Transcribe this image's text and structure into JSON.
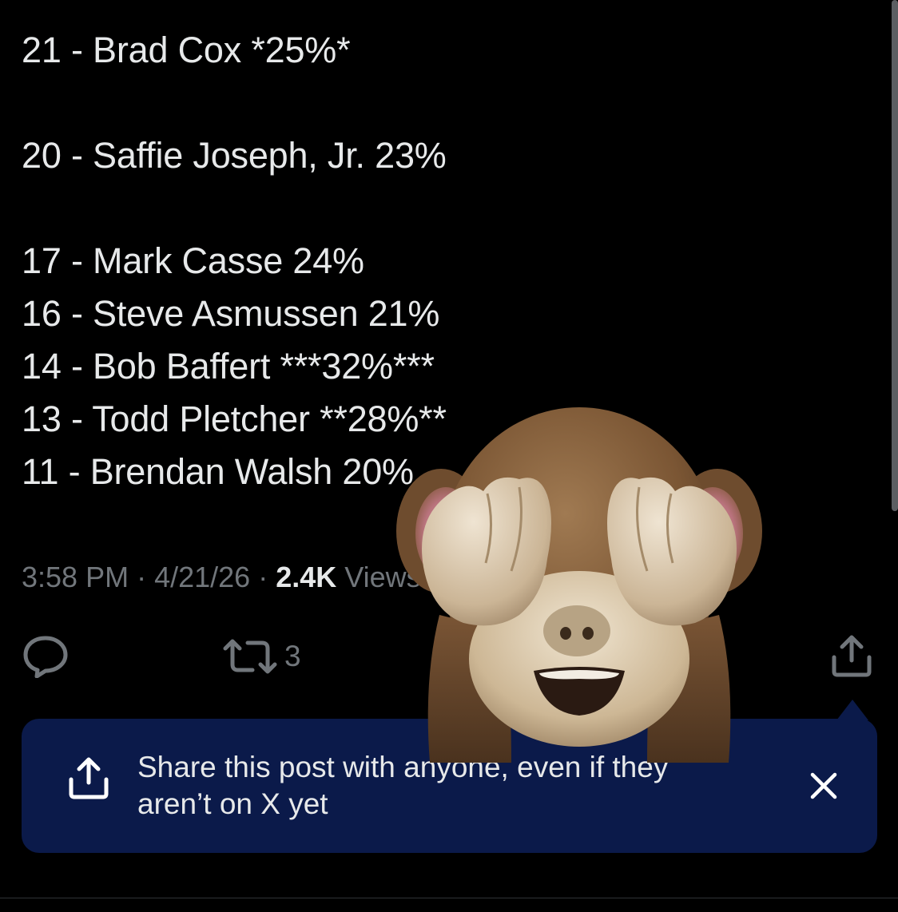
{
  "post": {
    "lines": [
      "21 - Brad Cox *25%*",
      "20 - Saffie Joseph, Jr. 23%",
      "17 - Mark Casse 24%",
      "16 - Steve Asmussen 21%",
      "14 - Bob Baffert ***32%***",
      "13 - Todd Pletcher **28%**",
      "11 - Brendan Walsh 20%"
    ]
  },
  "meta": {
    "time": "3:58 PM",
    "separator": " · ",
    "date": "4/21/26",
    "views_count": "2.4K",
    "views_label": " Views"
  },
  "actions": {
    "reply_icon": "reply-icon",
    "repost_icon": "repost-icon",
    "repost_count": "3",
    "share_icon": "share-icon"
  },
  "share_toast": {
    "message": "Share this post with anyone, even if they aren’t on X yet",
    "icon": "share-icon",
    "close_icon": "close-icon"
  },
  "sticker": {
    "icon": "see-no-evil-monkey-icon"
  },
  "colors": {
    "background": "#000000",
    "text": "#e7e9ea",
    "muted": "#71767b",
    "toast_background": "#0b1a4a"
  }
}
